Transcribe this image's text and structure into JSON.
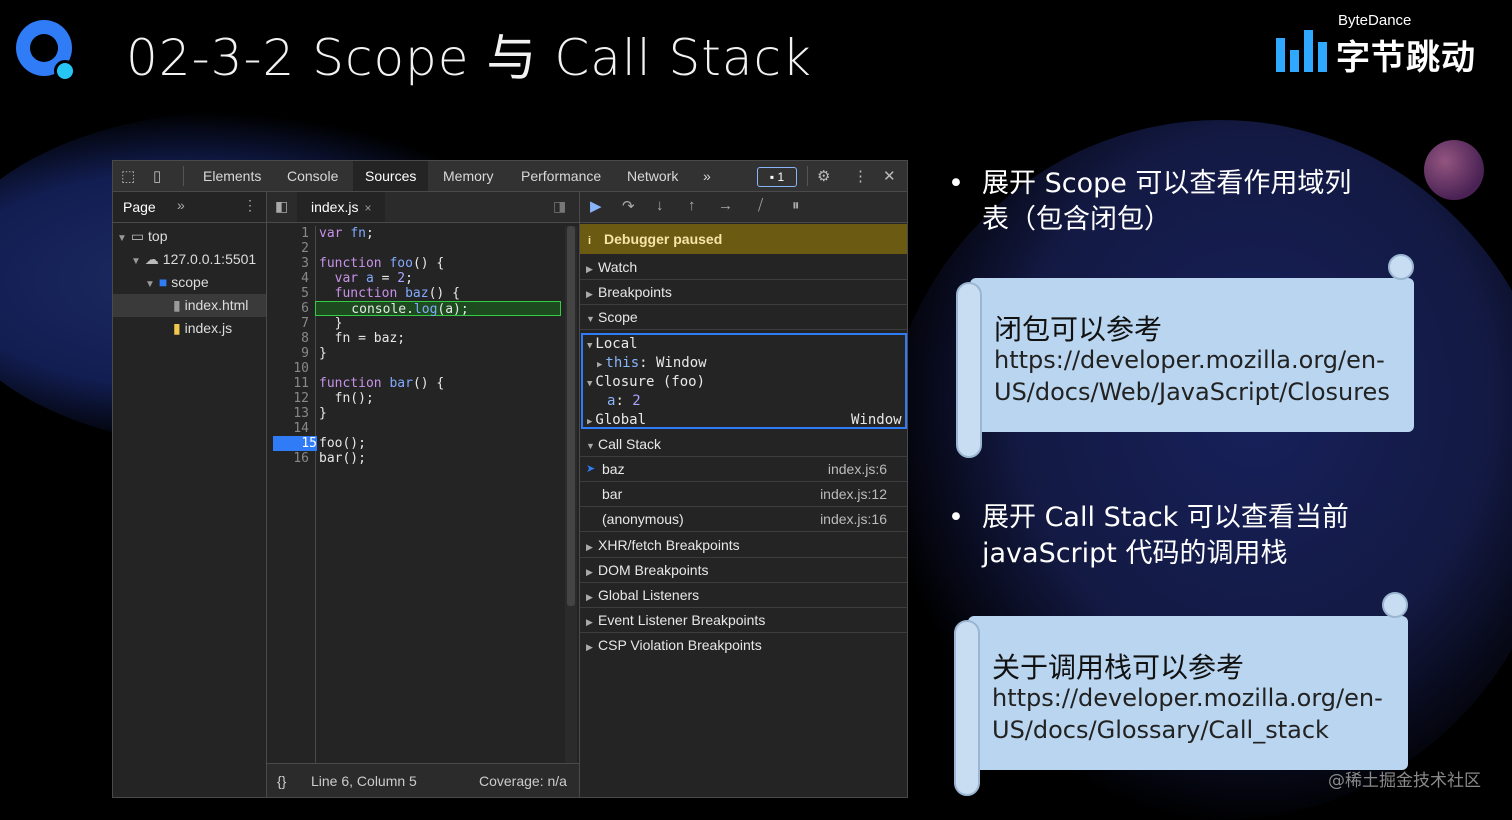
{
  "slide": {
    "title": "02-3-2 Scope 与 Call Stack",
    "brand_top": "ByteDance",
    "brand_main": "字节跳动",
    "watermark": "@稀土掘金技术社区"
  },
  "devtools": {
    "tabs": [
      "Elements",
      "Console",
      "Sources",
      "Memory",
      "Performance",
      "Network"
    ],
    "active_tab": "Sources",
    "more_tabs": "»",
    "issues_badge": "1",
    "navigator": {
      "title": "Page",
      "more": "»",
      "tree": [
        {
          "label": "top",
          "icon": "frame-icon"
        },
        {
          "label": "127.0.0.1:5501",
          "icon": "cloud-icon"
        },
        {
          "label": "scope",
          "icon": "folder-icon"
        },
        {
          "label": "index.html",
          "icon": "html-file-icon"
        },
        {
          "label": "index.js",
          "icon": "js-file-icon"
        }
      ],
      "selected": "index.html"
    },
    "editor": {
      "open_file": "index.js",
      "close_glyph": "×",
      "line_numbers": [
        "1",
        "2",
        "3",
        "4",
        "5",
        "6",
        "7",
        "8",
        "9",
        "10",
        "11",
        "12",
        "13",
        "14",
        "15",
        "16"
      ],
      "breakpoint_line": "15",
      "highlighted_line": "6",
      "footer_braces": "{}",
      "cursor_position": "Line 6, Column 5",
      "coverage": "Coverage: n/a"
    },
    "debugger": {
      "paused_banner": "Debugger paused",
      "sections_top": [
        "Watch",
        "Breakpoints",
        "Scope"
      ],
      "scope": {
        "local": "Local",
        "this_key": "this",
        "this_val": "Window",
        "closure": "Closure (foo)",
        "closure_var": "a",
        "closure_val": "2",
        "global": "Global",
        "global_val": "Window"
      },
      "call_stack_title": "Call Stack",
      "call_stack": [
        {
          "name": "baz",
          "location": "index.js:6"
        },
        {
          "name": "bar",
          "location": "index.js:12"
        },
        {
          "name": "(anonymous)",
          "location": "index.js:16"
        }
      ],
      "sections_bottom": [
        "XHR/fetch Breakpoints",
        "DOM Breakpoints",
        "Global Listeners",
        "Event Listener Breakpoints",
        "CSP Violation Breakpoints"
      ]
    }
  },
  "notes": {
    "bullet1_line1": "展开 Scope 可以查看作用域列",
    "bullet1_line2": "表（包含闭包）",
    "scroll1_head": "闭包可以参考",
    "scroll1_link1": "https://developer.mozilla.org/en-",
    "scroll1_link2": "US/docs/Web/JavaScript/Closures",
    "bullet2_line1": "展开 Call Stack 可以查看当前",
    "bullet2_line2": "javaScript 代码的调用栈",
    "scroll2_head": "关于调用栈可以参考",
    "scroll2_link1": "https://developer.mozilla.org/en-",
    "scroll2_link2": "US/docs/Glossary/Call_stack",
    "bullet_glyph": "•"
  },
  "colors": {
    "accent": "#2f7cf6",
    "paused_banner": "#6a5a12",
    "scroll_paper": "#b9d5ef"
  }
}
